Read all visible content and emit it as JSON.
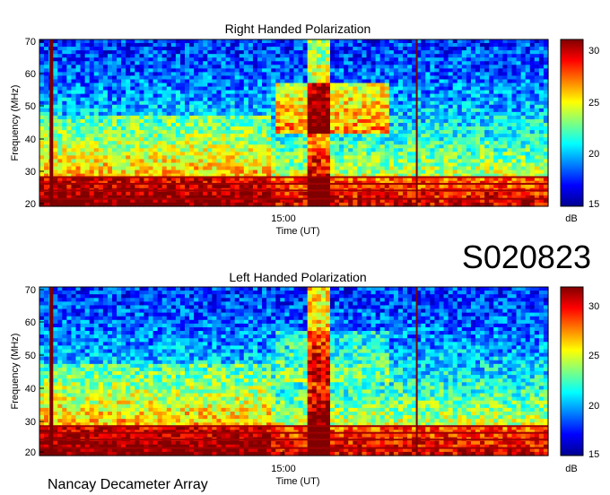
{
  "figure": {
    "observation_id": "S020823",
    "footer": "Nancay Decameter Array"
  },
  "chart_data": [
    {
      "type": "heatmap",
      "title": "Right Handed Polarization",
      "xlabel": "Time (UT)",
      "ylabel": "Frequency (MHz)",
      "x_ticks": [
        "15:00"
      ],
      "y_ticks": [
        "20",
        "30",
        "40",
        "50",
        "60",
        "70"
      ],
      "ylim": [
        20,
        70
      ],
      "colorbar": {
        "label": "dB",
        "ticks": [
          "15",
          "20",
          "25",
          "30"
        ],
        "range": [
          15,
          31
        ],
        "colormap": "jet"
      }
    },
    {
      "type": "heatmap",
      "title": "Left Handed Polarization",
      "xlabel": "Time (UT)",
      "ylabel": "Frequency (MHz)",
      "x_ticks": [
        "15:00"
      ],
      "y_ticks": [
        "20",
        "30",
        "40",
        "50",
        "60",
        "70"
      ],
      "ylim": [
        20,
        70
      ],
      "colorbar": {
        "label": "dB",
        "ticks": [
          "15",
          "20",
          "25",
          "30"
        ],
        "range": [
          15,
          32
        ],
        "colormap": "jet"
      }
    }
  ]
}
